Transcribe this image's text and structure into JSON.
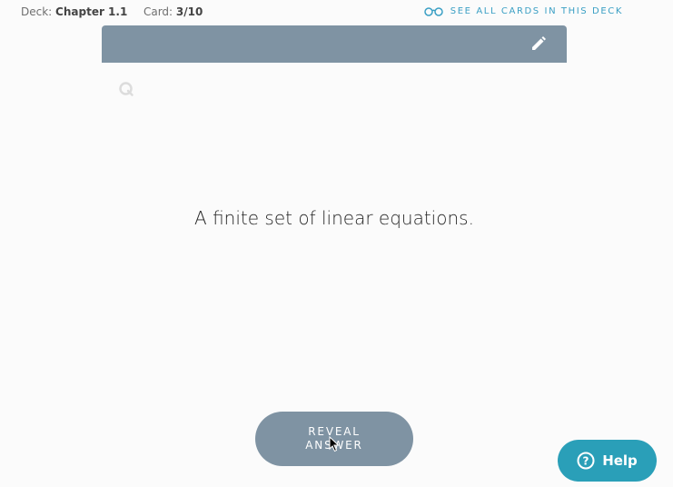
{
  "header": {
    "deck_label": "Deck:",
    "deck_name": "Chapter 1.1",
    "card_label": "Card:",
    "card_position": "3/10",
    "see_all_label": "SEE ALL CARDS IN THIS DECK",
    "see_all_icon": "glasses-icon"
  },
  "card": {
    "edit_icon": "pencil-icon",
    "quizlet_icon": "q-logo-icon",
    "question_text": "A finite set of linear equations."
  },
  "actions": {
    "reveal_label": "REVEAL ANSWER"
  },
  "help": {
    "label": "Help",
    "icon": "question-circle-icon"
  },
  "colors": {
    "card_header": "#7f93a3",
    "accent_link": "#3a9fc4",
    "help_button": "#2a9fb8",
    "background": "#fbfbfb"
  }
}
